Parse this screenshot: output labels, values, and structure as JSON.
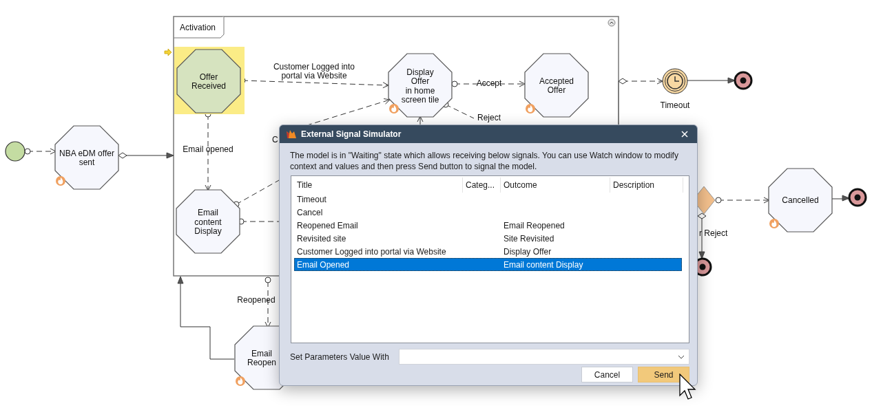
{
  "diagram": {
    "container": {
      "title": "Activation"
    },
    "nodes": [
      {
        "kind": "start"
      },
      {
        "kind": "task",
        "lines": [
          "NBA eDM offer",
          "sent"
        ],
        "flame": true,
        "active": false
      },
      {
        "kind": "task",
        "lines": [
          "Offer",
          "Received"
        ],
        "flame": false,
        "active": true
      },
      {
        "kind": "task",
        "lines": [
          "Display",
          "Offer",
          "in home",
          "screen tile"
        ],
        "flame": true,
        "active": false
      },
      {
        "kind": "task",
        "lines": [
          "Accepted",
          "Offer"
        ],
        "flame": true,
        "active": false
      },
      {
        "kind": "task",
        "lines": [
          "Email",
          "content",
          "Display"
        ],
        "flame": false,
        "active": false
      },
      {
        "kind": "timer",
        "lines": [
          "Timeout"
        ]
      },
      {
        "kind": "end"
      },
      {
        "kind": "gateway"
      },
      {
        "kind": "task",
        "lines": [
          "Cancelled"
        ],
        "flame": true,
        "active": false
      },
      {
        "kind": "end"
      },
      {
        "kind": "end"
      },
      {
        "kind": "task",
        "lines": [
          "Email",
          "Reopen"
        ],
        "flame": true,
        "active": false
      }
    ],
    "edge_labels": [
      {
        "lines": [
          "Customer Logged into",
          "portal via Website"
        ]
      },
      {
        "lines": [
          "Accept"
        ]
      },
      {
        "lines": [
          "Reject"
        ]
      },
      {
        "lines": [
          "Email opened"
        ]
      },
      {
        "lines": [
          "C"
        ]
      },
      {
        "lines": [
          "r Reject"
        ]
      },
      {
        "lines": [
          "Reopened"
        ]
      }
    ]
  },
  "dialog": {
    "title": "External Signal Simulator",
    "message": "The model is in \"Waiting\" state which allows receiving below signals. You can use Watch window to modify context and values and then press Send button to signal the model.",
    "columns": [
      "Title",
      "Categ...",
      "Outcome",
      "Description"
    ],
    "rows": [
      {
        "title": "Timeout",
        "selected": false
      },
      {
        "title": "Cancel",
        "selected": false
      },
      {
        "title": "Reopened Email",
        "outcome": "Email Reopened",
        "selected": false
      },
      {
        "title": "Revisited site",
        "outcome": "Site Revisited",
        "selected": false
      },
      {
        "title": "Customer Logged into portal via Website",
        "outcome": "Display Offer",
        "selected": false
      },
      {
        "title": "Email Opened",
        "outcome": "Email content Display",
        "selected": true
      }
    ],
    "parameter_label": "Set Parameters Value With",
    "buttons": [
      {
        "label": "Cancel",
        "kind": "secondary"
      },
      {
        "label": "Send",
        "kind": "primary"
      }
    ]
  }
}
